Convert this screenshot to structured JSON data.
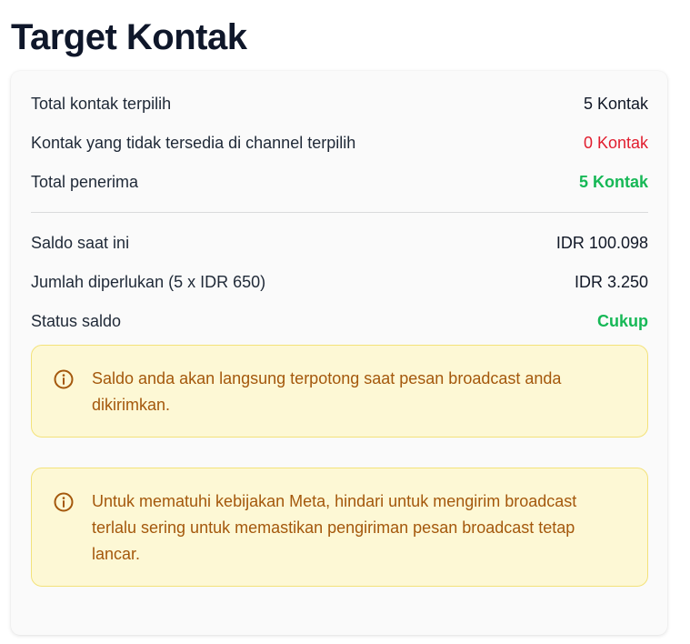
{
  "page": {
    "title": "Target Kontak"
  },
  "summary": {
    "rows": [
      {
        "label": "Total kontak terpilih",
        "value": "5 Kontak"
      },
      {
        "label": "Kontak yang tidak tersedia di channel terpilih",
        "value": "0 Kontak"
      },
      {
        "label": "Total penerima",
        "value": "5 Kontak"
      }
    ]
  },
  "balance": {
    "rows": [
      {
        "label": "Saldo saat ini",
        "value": "IDR 100.098"
      },
      {
        "label": "Jumlah diperlukan (5 x IDR 650)",
        "value": "IDR 3.250"
      },
      {
        "label": "Status saldo",
        "value": "Cukup"
      }
    ]
  },
  "alerts": [
    {
      "icon": "info-icon",
      "text": "Saldo anda akan langsung terpotong saat pesan broadcast anda dikirimkan."
    },
    {
      "icon": "info-icon",
      "text": "Untuk mematuhi kebijakan Meta, hindari untuk mengirim broadcast terlalu sering untuk memastikan pengiriman pesan broadcast tetap lancar."
    }
  ],
  "colors": {
    "negative": "#e11d2e",
    "positive": "#16b856",
    "alert_text": "#a4580c",
    "alert_bg": "#fdf8d5",
    "alert_border": "#f3e27a"
  }
}
